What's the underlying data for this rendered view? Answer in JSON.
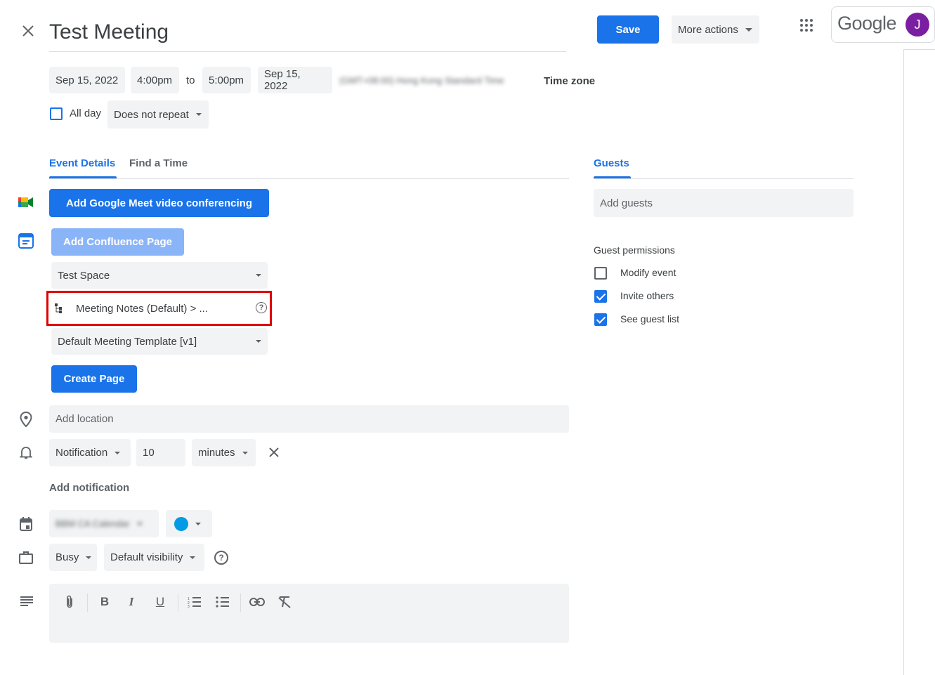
{
  "header": {
    "title": "Test Meeting",
    "save_label": "Save",
    "more_actions_label": "More actions",
    "brand": "Google",
    "avatar_initial": "J"
  },
  "datetime": {
    "start_date": "Sep 15, 2022",
    "start_time": "4:00pm",
    "to_label": "to",
    "end_time": "5:00pm",
    "end_date": "Sep 15, 2022",
    "timezone_display": "(GMT+08:00) Hong Kong Standard Time",
    "timezone_label": "Time zone",
    "all_day_label": "All day",
    "all_day_checked": false,
    "repeat_label": "Does not repeat"
  },
  "tabs": {
    "event_details": "Event Details",
    "find_time": "Find a Time",
    "guests": "Guests"
  },
  "meet_button": "Add Google Meet video conferencing",
  "confluence": {
    "add_page_label": "Add Confluence Page",
    "space_select": "Test Space",
    "parent_page": "Meeting Notes (Default) > ...",
    "template_select": "Default Meeting Template [v1]",
    "create_page_label": "Create Page"
  },
  "location_placeholder": "Add location",
  "notification": {
    "type": "Notification",
    "amount": "10",
    "unit": "minutes",
    "add_label": "Add notification"
  },
  "calendar": {
    "name": "BBM CA Calendar",
    "color": "#039be5"
  },
  "availability": {
    "busy": "Busy",
    "visibility": "Default visibility"
  },
  "guests": {
    "placeholder": "Add guests",
    "permissions_title": "Guest permissions",
    "permissions": [
      {
        "label": "Modify event",
        "checked": false
      },
      {
        "label": "Invite others",
        "checked": true
      },
      {
        "label": "See guest list",
        "checked": true
      }
    ]
  },
  "colors": {
    "accent": "#1a73e8",
    "highlight_box": "#e00000",
    "chip_bg": "#f1f3f4",
    "avatar_bg": "#7b1fa2"
  }
}
